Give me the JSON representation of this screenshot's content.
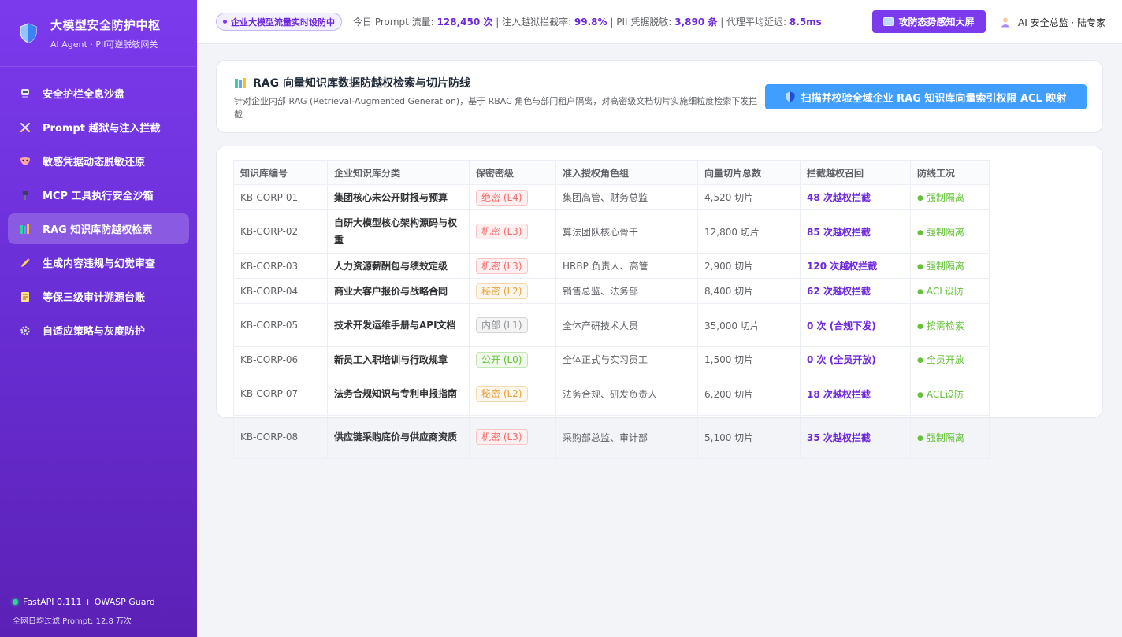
{
  "sidebar": {
    "title": "大模型安全防护中枢",
    "subtitle": "AI Agent · PII可逆脱敏网关",
    "items": [
      {
        "label": "安全护栏全息沙盘"
      },
      {
        "label": "Prompt 越狱与注入拦截"
      },
      {
        "label": "敏感凭据动态脱敏还原"
      },
      {
        "label": "MCP 工具执行安全沙箱"
      },
      {
        "label": "RAG 知识库防越权检索"
      },
      {
        "label": "生成内容违规与幻觉审查"
      },
      {
        "label": "等保三级审计溯源台账"
      },
      {
        "label": "自适应策略与灰度防护"
      }
    ],
    "footer": {
      "status": "FastAPI 0.111 + OWASP Guard",
      "daily": "全网日均过滤 Prompt: 12.8 万次"
    }
  },
  "header": {
    "live_badge": "企业大模型流量实时设防中",
    "stats": {
      "prompt_label": "今日 Prompt 流量: ",
      "prompt_value": "128,450 次",
      "sep1": " | 注入越狱拦截率: ",
      "block_rate": "99.8%",
      "sep2": " | PII 凭据脱敏: ",
      "pii_value": "3,890 条",
      "sep3": " | 代理平均延迟: ",
      "latency": "8.5ms"
    },
    "screen_button": "攻防态势感知大屏",
    "user": "AI 安全总监 · 陆专家"
  },
  "panel": {
    "title": "RAG 向量知识库数据防越权检索与切片防线",
    "description": "针对企业内部 RAG (Retrieval-Augmented Generation)，基于 RBAC 角色与部门租户隔离，对高密级文档切片实施细粒度检索下发拦截",
    "scan_button": "扫描并校验全域企业 RAG 知识库向量索引权限 ACL 映射"
  },
  "table": {
    "columns": [
      "知识库编号",
      "企业知识库分类",
      "保密密级",
      "准入授权角色组",
      "向量切片总数",
      "拦截越权召回",
      "防线工况"
    ],
    "rows": [
      {
        "id": "KB-CORP-01",
        "category": "集团核心未公开财报与预算",
        "level": "绝密 (L4)",
        "level_class": "l4",
        "roles": "集团高管、财务总监",
        "chunks": "4,520 切片",
        "intercept": "48 次越权拦截",
        "status": "强制隔离"
      },
      {
        "id": "KB-CORP-02",
        "category": "自研大模型核心架构源码与权重",
        "level": "机密 (L3)",
        "level_class": "l3",
        "roles": "算法团队核心骨干",
        "chunks": "12,800 切片",
        "intercept": "85 次越权拦截",
        "status": "强制隔离"
      },
      {
        "id": "KB-CORP-03",
        "category": "人力资源薪酬包与绩效定级",
        "level": "机密 (L3)",
        "level_class": "l3",
        "roles": "HRBP 负责人、高管",
        "chunks": "2,900 切片",
        "intercept": "120 次越权拦截",
        "status": "强制隔离"
      },
      {
        "id": "KB-CORP-04",
        "category": "商业大客户报价与战略合同",
        "level": "秘密 (L2)",
        "level_class": "l2",
        "roles": "销售总监、法务部",
        "chunks": "8,400 切片",
        "intercept": "62 次越权拦截",
        "status": "ACL设防"
      },
      {
        "id": "KB-CORP-05",
        "category": "技术开发运维手册与API文档",
        "level": "内部 (L1)",
        "level_class": "l1",
        "roles": "全体产研技术人员",
        "chunks": "35,000 切片",
        "intercept": "0 次 (合规下发)",
        "status": "按需检索"
      },
      {
        "id": "KB-CORP-06",
        "category": "新员工入职培训与行政规章",
        "level": "公开 (L0)",
        "level_class": "l0",
        "roles": "全体正式与实习员工",
        "chunks": "1,500 切片",
        "intercept": "0 次 (全员开放)",
        "status": "全员开放"
      },
      {
        "id": "KB-CORP-07",
        "category": "法务合规知识与专利申报指南",
        "level": "秘密 (L2)",
        "level_class": "l2",
        "roles": "法务合规、研发负责人",
        "chunks": "6,200 切片",
        "intercept": "18 次越权拦截",
        "status": "ACL设防"
      },
      {
        "id": "KB-CORP-08",
        "category": "供应链采购底价与供应商资质",
        "level": "机密 (L3)",
        "level_class": "l3",
        "roles": "采购部总监、审计部",
        "chunks": "5,100 切片",
        "intercept": "35 次越权拦截",
        "status": "强制隔离"
      }
    ]
  }
}
